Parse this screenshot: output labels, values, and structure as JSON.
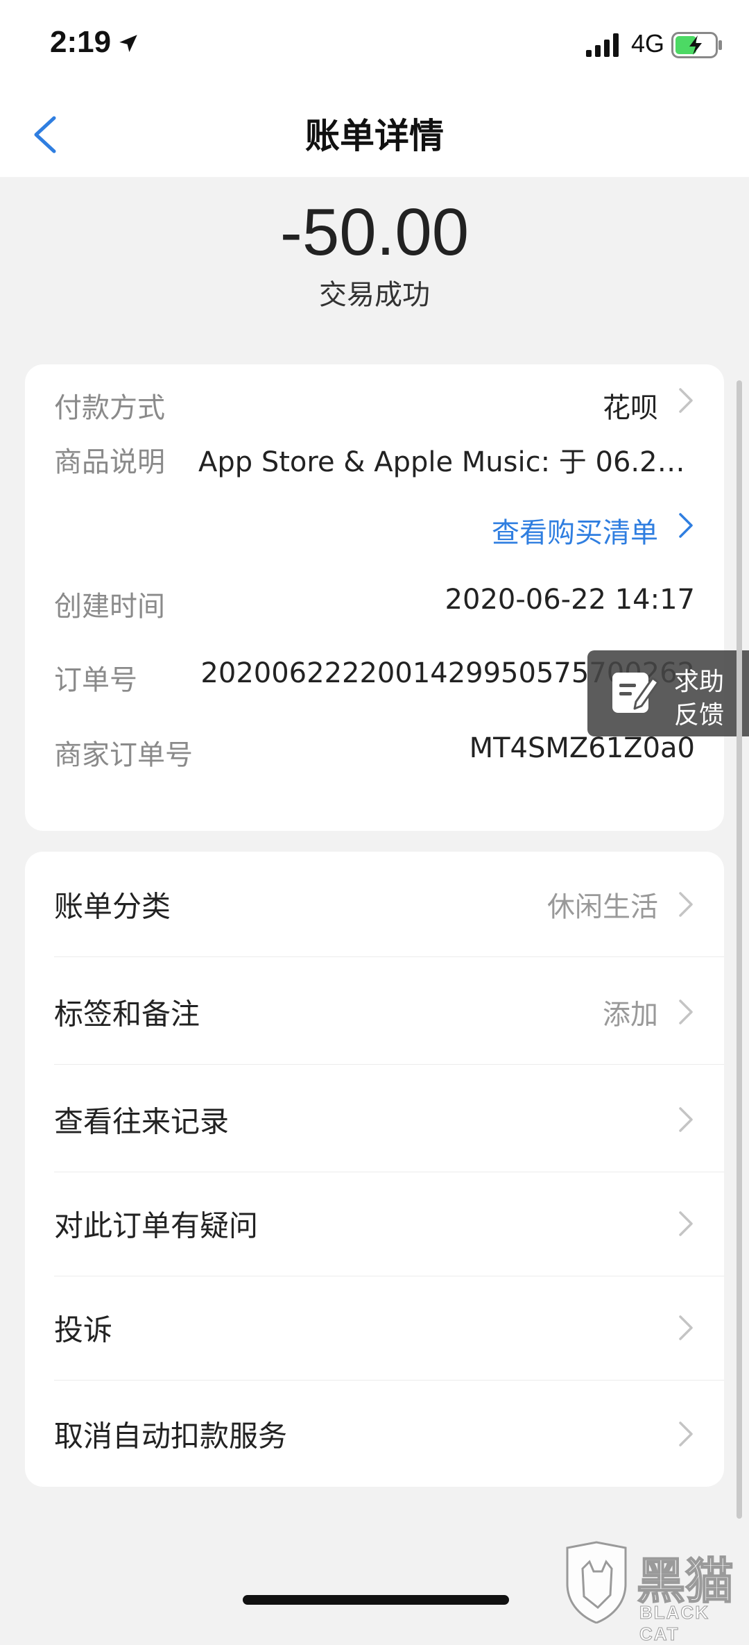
{
  "status_bar": {
    "time": "2:19",
    "network": "4G",
    "icons": [
      "location-arrow-icon",
      "signal-bars-icon",
      "battery-charging-icon"
    ]
  },
  "nav": {
    "back_icon": "chevron-left-icon",
    "title": "账单详情"
  },
  "transaction": {
    "amount": "-50.00",
    "status": "交易成功"
  },
  "details": {
    "payment_method_label": "付款方式",
    "payment_method_value": "花呗",
    "product_label": "商品说明",
    "product_value": "App Store & Apple Music: 于 06.22...",
    "purchase_list_link": "查看购买清单",
    "created_time_label": "创建时间",
    "created_time_value": "2020-06-22 14:17",
    "order_no_label": "订单号",
    "order_no_value": "2020062222001429950575700262",
    "merchant_order_label": "商家订单号",
    "merchant_order_value": "MT4SMZ61Z0a0"
  },
  "actions": [
    {
      "label": "账单分类",
      "value": "休闲生活"
    },
    {
      "label": "标签和备注",
      "value": "添加"
    },
    {
      "label": "查看往来记录",
      "value": ""
    },
    {
      "label": "对此订单有疑问",
      "value": ""
    },
    {
      "label": "投诉",
      "value": ""
    },
    {
      "label": "取消自动扣款服务",
      "value": ""
    }
  ],
  "feedback": {
    "line1": "求助",
    "line2": "反馈",
    "icon": "edit-note-icon"
  },
  "watermark": {
    "cn": "黑猫",
    "en": "BLACK CAT"
  },
  "colors": {
    "link": "#2f7ee0",
    "background": "#f2f2f2",
    "card": "#ffffff",
    "back_arrow": "#2f7ee0"
  }
}
